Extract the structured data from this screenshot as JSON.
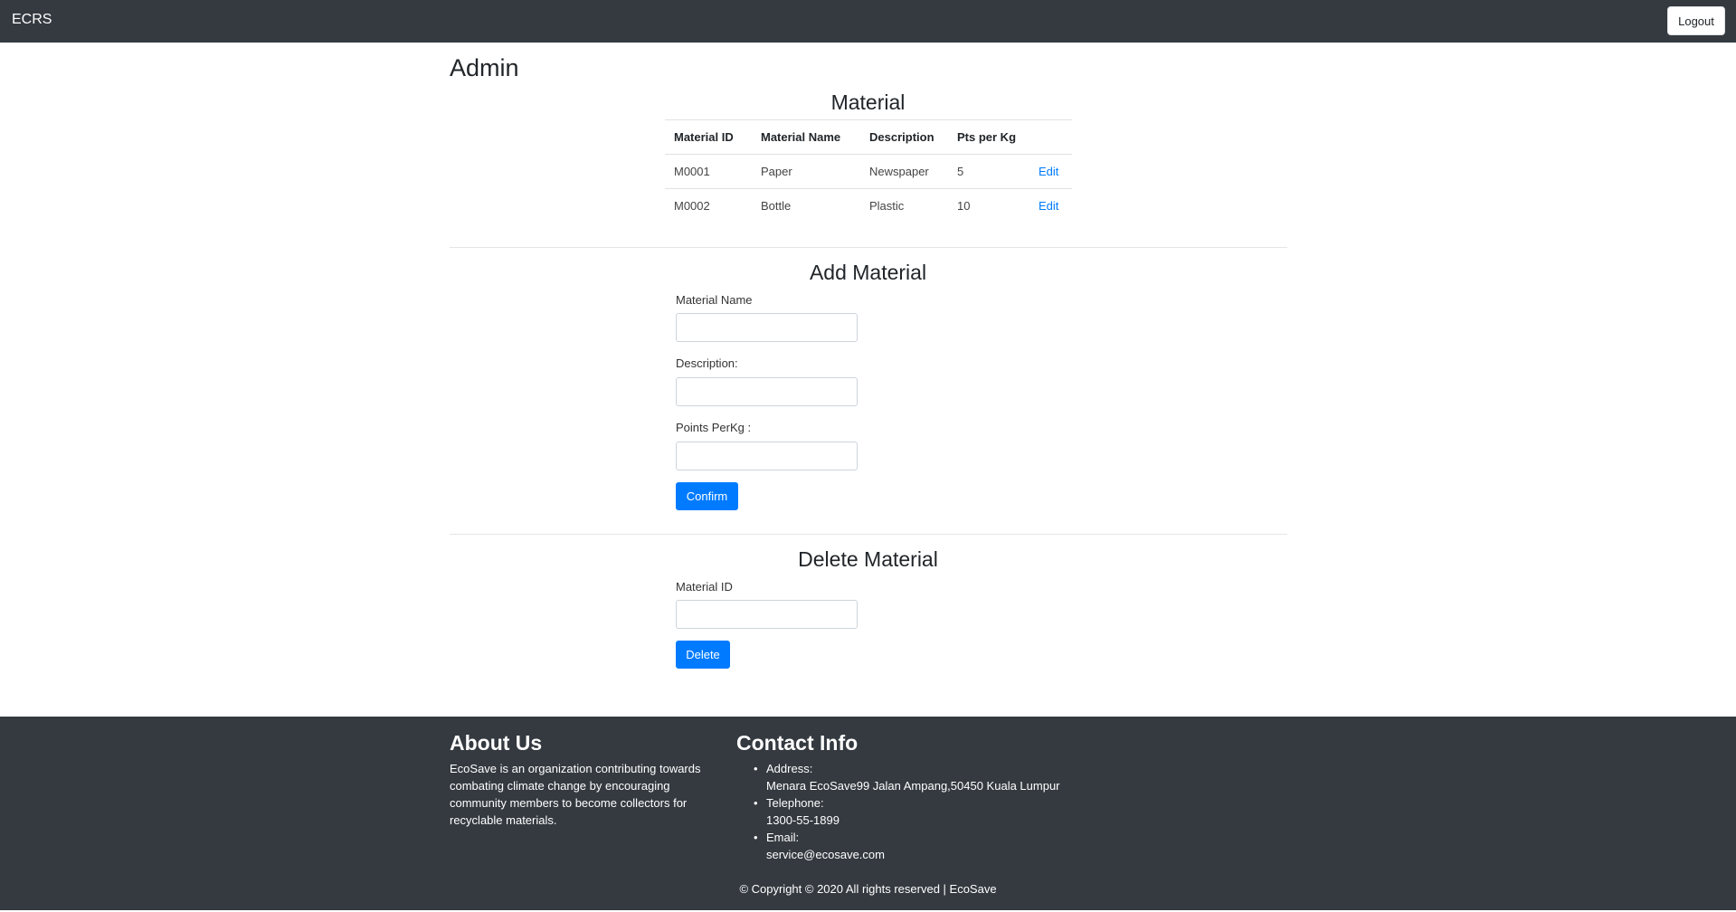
{
  "navbar": {
    "brand": "ECRS",
    "logout_label": "Logout"
  },
  "page_title": "Admin",
  "material_section": {
    "title": "Material",
    "columns": [
      "Material ID",
      "Material Name",
      "Description",
      "Pts per Kg",
      ""
    ],
    "rows": [
      {
        "id": "M0001",
        "name": "Paper",
        "description": "Newspaper",
        "points": "5",
        "action": "Edit"
      },
      {
        "id": "M0002",
        "name": "Bottle",
        "description": "Plastic",
        "points": "10",
        "action": "Edit"
      }
    ]
  },
  "add_section": {
    "title": "Add Material",
    "name_label": "Material Name",
    "name_value": "",
    "description_label": "Description:",
    "description_value": "",
    "points_label": "Points PerKg :",
    "points_value": "",
    "confirm_label": "Confirm"
  },
  "delete_section": {
    "title": "Delete Material",
    "id_label": "Material ID",
    "id_value": "",
    "delete_label": "Delete"
  },
  "footer": {
    "about_title": "About Us",
    "about_text": "EcoSave is an organization contributing towards combating climate change by encouraging community members to become collectors for recyclable materials.",
    "contact_title": "Contact Info",
    "address_label": "Address:",
    "address_value": "Menara EcoSave99 Jalan Ampang,50450 Kuala Lumpur",
    "telephone_label": "Telephone:",
    "telephone_value": "1300-55-1899",
    "email_label": "Email:",
    "email_value": "service@ecosave.com",
    "copyright": "© Copyright © 2020 All rights reserved | EcoSave"
  },
  "colors": {
    "navbar": "#343a40",
    "primary": "#007bff",
    "link": "#007bff"
  }
}
